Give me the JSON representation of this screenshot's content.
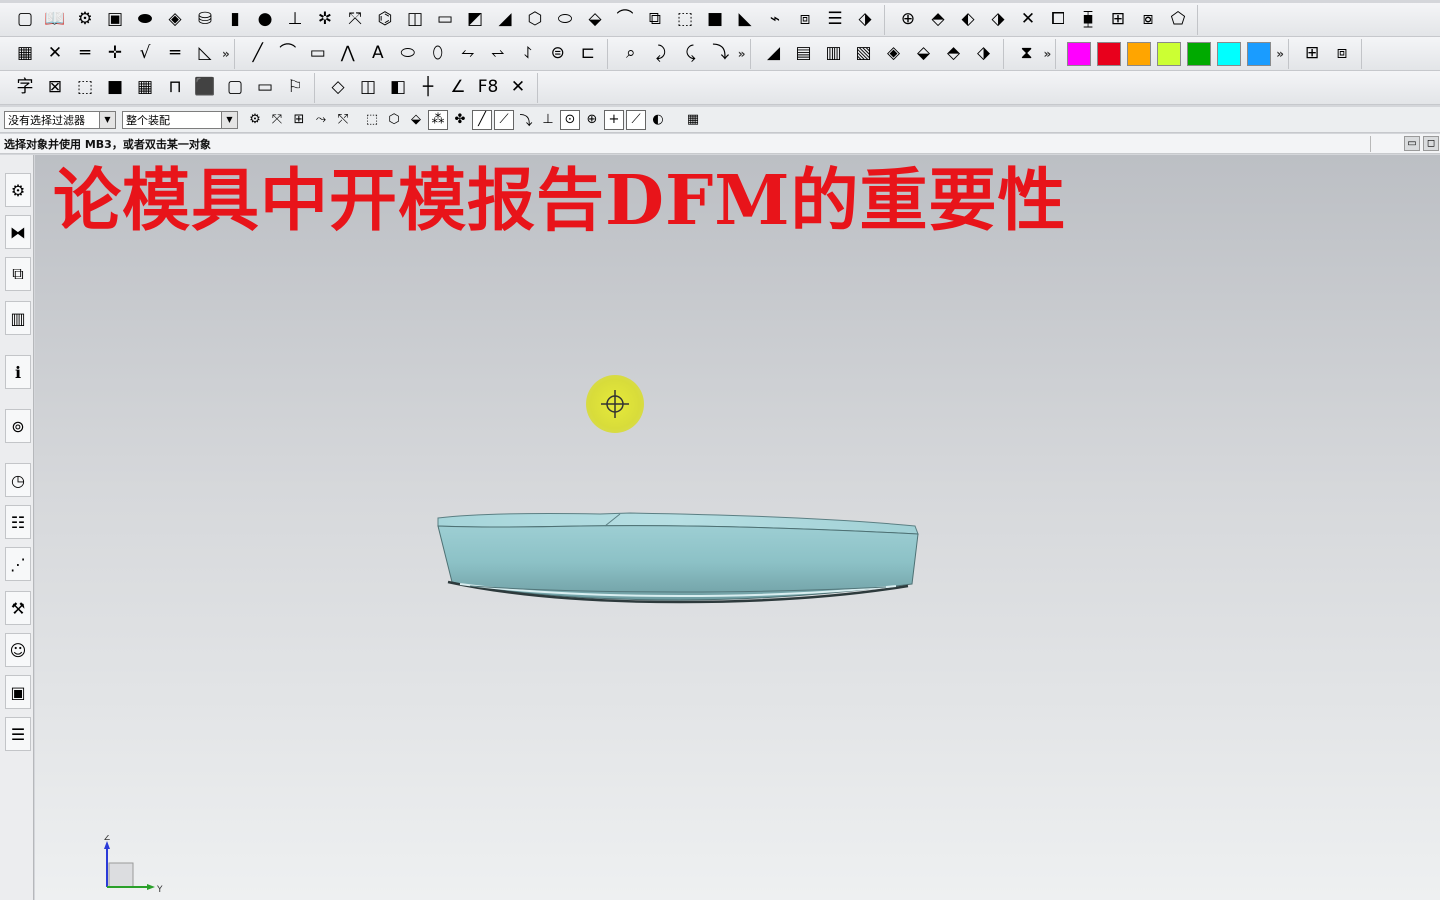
{
  "toolbar_rows": {
    "row1": [
      {
        "name": "new-file-icon",
        "glyph": "▢"
      },
      {
        "name": "open-book-icon",
        "glyph": "📖"
      },
      {
        "name": "assembly-icon",
        "glyph": "⚙"
      },
      {
        "name": "block-icon",
        "glyph": "▣"
      },
      {
        "name": "pad-icon",
        "glyph": "⬬"
      },
      {
        "name": "blend-icon",
        "glyph": "◈"
      },
      {
        "name": "cylinder-icon",
        "glyph": "⛁"
      },
      {
        "name": "cylinder-blue-icon",
        "glyph": "▮"
      },
      {
        "name": "sphere-icon",
        "glyph": "●"
      },
      {
        "name": "extrude-icon",
        "glyph": "⊥"
      },
      {
        "name": "feature-pattern-icon",
        "glyph": "✲"
      },
      {
        "name": "transform-icon",
        "glyph": "⤧"
      },
      {
        "name": "hole-icon",
        "glyph": "⌬"
      },
      {
        "name": "mirror-book-icon",
        "glyph": "◫"
      },
      {
        "name": "boss-icon",
        "glyph": "▭"
      },
      {
        "name": "shell-icon",
        "glyph": "◩"
      },
      {
        "name": "draft-icon",
        "glyph": "◢"
      },
      {
        "name": "trim-body-icon",
        "glyph": "⬡"
      },
      {
        "name": "offset-face-icon",
        "glyph": "⬭"
      },
      {
        "name": "chamfer-icon",
        "glyph": "⬙"
      },
      {
        "name": "edge-blend-icon",
        "glyph": "⌒"
      },
      {
        "name": "split-body-icon",
        "glyph": "⧉"
      },
      {
        "name": "thicken-icon",
        "glyph": "⬚"
      },
      {
        "name": "box-solid-icon",
        "glyph": "■"
      },
      {
        "name": "sheet-icon",
        "glyph": "◣"
      },
      {
        "name": "sweep-icon",
        "glyph": "⌁"
      },
      {
        "name": "swept-box-icon",
        "glyph": "⧈"
      },
      {
        "name": "layers-icon",
        "glyph": "☰"
      },
      {
        "name": "solid-tool-icon",
        "glyph": "⬗"
      },
      {
        "name": "mold-tool1-icon",
        "glyph": "⊕"
      },
      {
        "name": "mold-tool2-icon",
        "glyph": "⬘"
      },
      {
        "name": "mold-tool3-icon",
        "glyph": "⬖"
      },
      {
        "name": "mold-tool4-icon",
        "glyph": "⬗"
      },
      {
        "name": "mold-tool5-icon",
        "glyph": "✕"
      },
      {
        "name": "mold-tool6-icon",
        "glyph": "⧠"
      },
      {
        "name": "mold-tool7-icon",
        "glyph": "⧯"
      },
      {
        "name": "mold-tool8-icon",
        "glyph": "⊞"
      },
      {
        "name": "mold-tool9-icon",
        "glyph": "⧇"
      },
      {
        "name": "mold-tool10-icon",
        "glyph": "⬠"
      }
    ],
    "row2": [
      {
        "name": "display-icon",
        "glyph": "▦"
      },
      {
        "name": "snap-icon",
        "glyph": "✕"
      },
      {
        "name": "measure-icon",
        "glyph": "═"
      },
      {
        "name": "point-icon",
        "glyph": "✛"
      },
      {
        "name": "analysis-icon",
        "glyph": "√"
      },
      {
        "name": "datum-plane-icon",
        "glyph": "═"
      },
      {
        "name": "sketch-icon",
        "glyph": "◺"
      },
      {
        "name": "line-icon",
        "glyph": "╱"
      },
      {
        "name": "arc-icon",
        "glyph": "⌒"
      },
      {
        "name": "rectangle-icon",
        "glyph": "▭"
      },
      {
        "name": "polyline-icon",
        "glyph": "⋀"
      },
      {
        "name": "text-icon",
        "glyph": "A"
      },
      {
        "name": "spline-icon",
        "glyph": "⬭"
      },
      {
        "name": "curve-offset-icon",
        "glyph": "⬯"
      },
      {
        "name": "curve-bridge-icon",
        "glyph": "⥊"
      },
      {
        "name": "curve-project-icon",
        "glyph": "⥋"
      },
      {
        "name": "curve-combine-icon",
        "glyph": "⥌"
      },
      {
        "name": "curve-wrap-icon",
        "glyph": "⊜"
      },
      {
        "name": "curve-split-icon",
        "glyph": "⊏"
      },
      {
        "name": "edit-curve-icon",
        "glyph": "⌕"
      },
      {
        "name": "trim-curve-icon",
        "glyph": "⤸"
      },
      {
        "name": "curve-length-icon",
        "glyph": "⤹"
      },
      {
        "name": "fillet-curve-icon",
        "glyph": "⤵"
      },
      {
        "name": "surface-through-curves-icon",
        "glyph": "◢"
      },
      {
        "name": "surface-mesh-icon",
        "glyph": "▤"
      },
      {
        "name": "surface-grid-icon",
        "glyph": "▥"
      },
      {
        "name": "surface-offset-icon",
        "glyph": "▧"
      },
      {
        "name": "surface-extend-icon",
        "glyph": "◈"
      },
      {
        "name": "surface-trim-icon",
        "glyph": "⬙"
      },
      {
        "name": "surface-sew-icon",
        "glyph": "⬘"
      },
      {
        "name": "surface-patch-icon",
        "glyph": "⬗"
      },
      {
        "name": "view-clip-icon",
        "glyph": "⧗"
      }
    ],
    "row3": [
      {
        "name": "text-character-icon",
        "glyph": "字"
      },
      {
        "name": "dimension-icon",
        "glyph": "⊠"
      },
      {
        "name": "body-wire-icon",
        "glyph": "⬚"
      },
      {
        "name": "body-yellow-icon",
        "glyph": "■"
      },
      {
        "name": "color-grid-icon",
        "glyph": "▦"
      },
      {
        "name": "fixture-icon",
        "glyph": "⊓"
      },
      {
        "name": "solid-red-icon",
        "glyph": "⬛"
      },
      {
        "name": "square-dashed-icon",
        "glyph": "▢"
      },
      {
        "name": "slot-icon",
        "glyph": "▭"
      },
      {
        "name": "flag-icon",
        "glyph": "⚐"
      },
      {
        "name": "layer-icon",
        "glyph": "◇"
      },
      {
        "name": "book-mirror-icon",
        "glyph": "◫"
      },
      {
        "name": "mirror-body-icon",
        "glyph": "◧"
      },
      {
        "name": "crosshair-icon",
        "glyph": "┼"
      },
      {
        "name": "angle-icon",
        "glyph": "∠"
      },
      {
        "name": "f8-icon",
        "glyph": "F8"
      },
      {
        "name": "delete-x-icon",
        "glyph": "✕"
      }
    ]
  },
  "color_swatches": [
    "#ff00ff",
    "#e8001c",
    "#ffa500",
    "#ccff33",
    "#00aa00",
    "#00ffff",
    "#1a9cff"
  ],
  "selection_bar": {
    "filter_value": "没有选择过滤器",
    "scope_value": "整个装配"
  },
  "cue_line": {
    "text": "选择对象并使用 MB3，或者双击某一对象"
  },
  "graphics_window": {
    "overlay_title": "论模具中开模报告DFM的重要性",
    "model_color": "#8fc3c9"
  },
  "resource_bar": [
    {
      "name": "assembly-navigator-icon",
      "glyph": "⚙"
    },
    {
      "name": "constraint-navigator-icon",
      "glyph": "⧓"
    },
    {
      "name": "part-navigator-icon",
      "glyph": "⧉"
    },
    {
      "name": "reuse-library-icon",
      "glyph": "▥"
    },
    {
      "name": "info-icon",
      "glyph": "ℹ"
    },
    {
      "name": "web-browser-icon",
      "glyph": "⊚"
    },
    {
      "name": "history-clock-icon",
      "glyph": "◷"
    },
    {
      "name": "system-materials-icon",
      "glyph": "☷"
    },
    {
      "name": "process-studio-icon",
      "glyph": "⋰"
    },
    {
      "name": "manufacturing-wizard-icon",
      "glyph": "⚒"
    },
    {
      "name": "roles-icon",
      "glyph": "☺"
    },
    {
      "name": "system-visualization-icon",
      "glyph": "▣"
    },
    {
      "name": "palette-icon",
      "glyph": "☰"
    }
  ],
  "wcs_triad": {
    "z_label": "Z",
    "y_label": "Y"
  }
}
